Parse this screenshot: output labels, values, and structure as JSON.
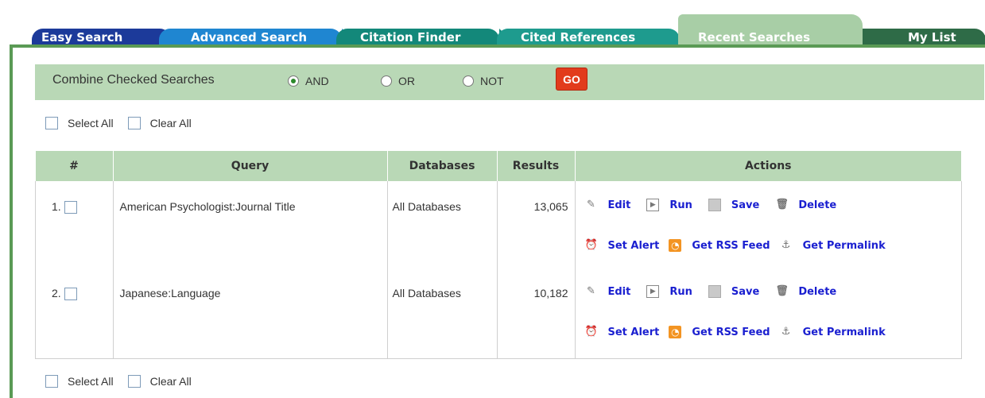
{
  "tabs": [
    "Easy Search",
    "Advanced Search",
    "Citation Finder",
    "Cited References",
    "Recent Searches",
    "My List"
  ],
  "combine": {
    "label": "Combine Checked Searches",
    "options": [
      "AND",
      "OR",
      "NOT"
    ],
    "selected": "AND",
    "go": "GO"
  },
  "select_all": "Select All",
  "clear_all": "Clear All",
  "table": {
    "headers": [
      "#",
      "Query",
      "Databases",
      "Results",
      "Actions"
    ],
    "rows": [
      {
        "num": "1.",
        "query": "American Psychologist:Journal Title",
        "databases": "All Databases",
        "results": "13,065"
      },
      {
        "num": "2.",
        "query": "Japanese:Language",
        "databases": "All Databases",
        "results": "10,182"
      }
    ]
  },
  "actions": {
    "edit": "Edit",
    "run": "Run",
    "save": "Save",
    "delete": "Delete",
    "set_alert": "Set Alert",
    "rss": "Get RSS Feed",
    "permalink": "Get Permalink"
  },
  "colors": {
    "accent_green": "#5a9a55",
    "link": "#1a1fd0",
    "go": "#e23b1c"
  }
}
